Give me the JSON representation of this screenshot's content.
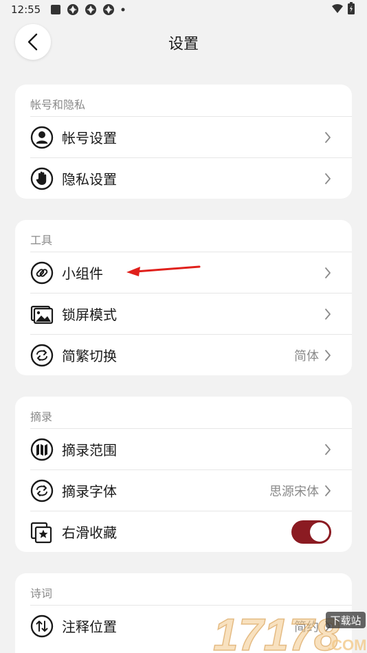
{
  "status_bar": {
    "time": "12:55"
  },
  "header": {
    "title": "设置"
  },
  "sections": [
    {
      "title": "帐号和隐私",
      "rows": [
        {
          "label": "帐号设置",
          "icon": "user-icon"
        },
        {
          "label": "隐私设置",
          "icon": "hand-icon"
        }
      ]
    },
    {
      "title": "工具",
      "rows": [
        {
          "label": "小组件",
          "icon": "link-icon"
        },
        {
          "label": "锁屏模式",
          "icon": "image-icon"
        },
        {
          "label": "简繁切换",
          "icon": "swap-icon",
          "value": "简体"
        }
      ]
    },
    {
      "title": "摘录",
      "rows": [
        {
          "label": "摘录范围",
          "icon": "map-icon"
        },
        {
          "label": "摘录字体",
          "icon": "swap-icon",
          "value": "思源宋体"
        },
        {
          "label": "右滑收藏",
          "icon": "star-collection-icon",
          "toggle_on": true
        }
      ]
    },
    {
      "title": "诗词",
      "rows": [
        {
          "label": "注释位置",
          "icon": "updown-icon",
          "value": "简约"
        }
      ]
    }
  ],
  "colors": {
    "accent": "#8b1b22",
    "annotation_arrow": "#e0201b"
  },
  "watermark": {
    "number": "17178",
    "tag": "下载站",
    "domain": ".COM"
  }
}
